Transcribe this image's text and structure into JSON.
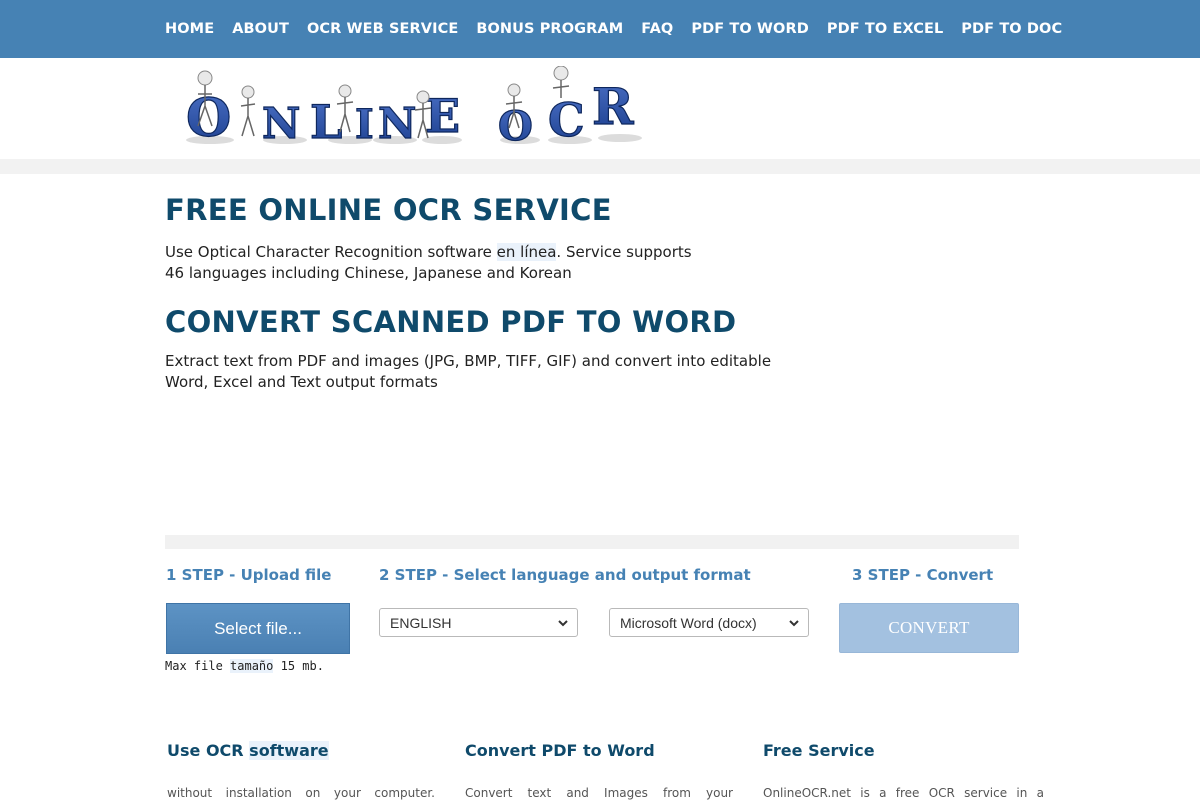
{
  "nav": {
    "items": [
      "HOME",
      "ABOUT",
      "OCR WEB SERVICE",
      "BONUS PROGRAM",
      "FAQ",
      "PDF TO WORD",
      "PDF TO EXCEL",
      "PDF TO DOC"
    ]
  },
  "logo": {
    "text": "ONLINE OCR"
  },
  "section1": {
    "title": "FREE ONLINE OCR SERVICE",
    "line1_pre": "Use Optical Character Recognition software ",
    "line1_hl": "en línea",
    "line1_post": ". Service supports",
    "line2": "46 languages including Chinese, Japanese and Korean"
  },
  "section2": {
    "title": "CONVERT SCANNED PDF TO WORD",
    "line1": "Extract text from PDF and images (JPG, BMP, TIFF, GIF) and convert into editable",
    "line2": "Word, Excel and Text output formats"
  },
  "steps": {
    "step1": "1 STEP - Upload file",
    "step2": "2 STEP - Select language and output format",
    "step3": "3 STEP - Convert"
  },
  "upload": {
    "button_label": "Select file...",
    "note_pre": "Max file ",
    "note_hl": "tamaño",
    "note_post": " 15 mb."
  },
  "language_select": {
    "selected": "ENGLISH"
  },
  "format_select": {
    "selected": "Microsoft Word (docx)"
  },
  "convert": {
    "label": "CONVERT"
  },
  "features": [
    {
      "title_pre": "Use OCR ",
      "title_hl": "software",
      "text": "without installation on your computer."
    },
    {
      "title": "Convert PDF to Word",
      "text": "Convert text and Images from your"
    },
    {
      "title": "Free Service",
      "text": "OnlineOCR.net is a free OCR service in a"
    }
  ],
  "colors": {
    "nav_bg": "#4682b4",
    "heading": "#0f4a6b",
    "step_title": "#4682b4",
    "convert_disabled": "#a3c1e0"
  }
}
